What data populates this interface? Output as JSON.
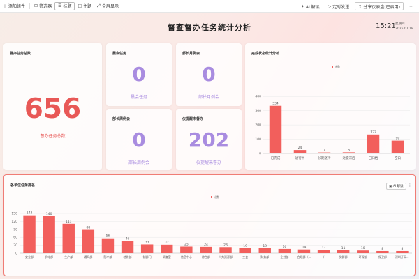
{
  "toolbar": {
    "add_component": "添加组件",
    "filter": "筛选器",
    "title": "标题",
    "theme": "主题",
    "fullscreen": "全屏显示",
    "ai_interpret": "AI 解读",
    "schedule_send": "定时发送",
    "share": "分享仪表盘(已启用)"
  },
  "header": {
    "title": "督查督办任务统计分析",
    "time": "15:21",
    "weekday": "星期四",
    "date": "2025.07.18"
  },
  "total_card": {
    "label": "督办任务总数",
    "value": "656",
    "caption": "督办任务总数"
  },
  "kpis": [
    {
      "label": "晨会任务",
      "value": "0",
      "caption": "晨会任务"
    },
    {
      "label": "部长月例会",
      "value": "0",
      "caption": "部长月例会"
    },
    {
      "label": "部长周例会",
      "value": "0",
      "caption": "部长周例会"
    },
    {
      "label": "仪提醒未督办",
      "value": "202",
      "caption": "仪提醒未督办"
    }
  ],
  "status_chart": {
    "title": "完成状态统计分析",
    "legend": "计数",
    "accent": "#f25f5c"
  },
  "dept_chart": {
    "title": "各单位任务排名",
    "legend": "计数",
    "ai_label": "AI 解读",
    "accent": "#f25f5c"
  },
  "chart_data": [
    {
      "type": "bar",
      "title": "完成状态统计分析",
      "categories": [
        "已完成",
        "进行中",
        "长期坚持",
        "进度滞后",
        "已归档",
        "空白"
      ],
      "values": [
        334,
        24,
        7,
        8,
        133,
        90
      ],
      "series": [
        {
          "name": "计数",
          "values": [
            334,
            24,
            7,
            8,
            133,
            90
          ]
        }
      ],
      "ylim": [
        0,
        450
      ],
      "yticks": [
        0,
        100,
        200,
        300,
        400
      ],
      "grid": true,
      "legend": "top-center"
    },
    {
      "type": "bar",
      "title": "各单位任务排名",
      "categories": [
        "安全部",
        "机电部",
        "生产部",
        "通风部",
        "防冲部",
        "地质部",
        "制部门",
        "调度室",
        "信息中心",
        "综合部",
        "人力资源部",
        "工会",
        "财务部",
        "企划部",
        "合规部（...",
        "/",
        "党群部",
        "环保部",
        "保卫部",
        "深圳开采..."
      ],
      "values": [
        143,
        140,
        111,
        88,
        56,
        46,
        33,
        32,
        25,
        24,
        23,
        19,
        19,
        16,
        14,
        13,
        11,
        10,
        8,
        8
      ],
      "series": [
        {
          "name": "计数",
          "values": [
            143,
            140,
            111,
            88,
            56,
            46,
            33,
            32,
            25,
            24,
            23,
            19,
            19,
            16,
            14,
            13,
            11,
            10,
            8,
            8
          ]
        }
      ],
      "ylim": [
        0,
        150
      ],
      "yticks": [
        0,
        30,
        60,
        90,
        120,
        150
      ],
      "grid": true,
      "legend": "top-center"
    }
  ]
}
